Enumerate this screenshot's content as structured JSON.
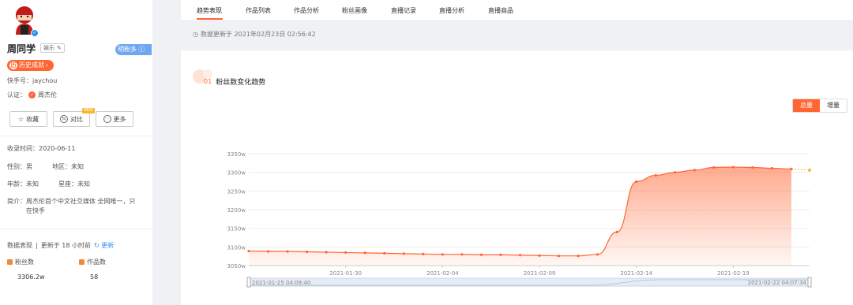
{
  "profile": {
    "name": "周同学",
    "category_tag": "娱乐",
    "fans_many_badge": "明粉多",
    "history_label": "历史成就",
    "kuaishou_id": "快手号：jaychou",
    "cert_label": "认证：",
    "cert_value": "周杰伦",
    "collect_button": "收藏",
    "compare_button": "对比",
    "compare_new": "NEW",
    "more_button": "更多",
    "collected_time": "收录时间：2020-06-11",
    "gender": "性别：男",
    "region": "地区：未知",
    "age": "年龄：未知",
    "zodiac": "星座：未知",
    "intro_label": "简介：",
    "intro_text": "周杰伦首个中文社交媒体 全网唯一，只在快手",
    "data_perf": "数据表现",
    "updated_ago": "更新于 18 小时前",
    "refresh": "更新",
    "fans_label": "粉丝数",
    "fans_value": "3306.2w",
    "works_label": "作品数",
    "works_value": "58"
  },
  "tabs": [
    "趋势表现",
    "作品列表",
    "作品分析",
    "粉丝画像",
    "直播记录",
    "直播分析",
    "直播商品"
  ],
  "update_info": "数据更新于 2021年02月23日 02:56:42",
  "section": {
    "num": "01",
    "title": "粉丝数变化趋势"
  },
  "toggle": {
    "total": "总量",
    "increment": "增量"
  },
  "chart_data": {
    "type": "area",
    "yunit": "w",
    "ylim": [
      3050,
      3350
    ],
    "yticks": [
      "3350w",
      "3300w",
      "3250w",
      "3200w",
      "3150w",
      "3100w",
      "3050w"
    ],
    "xticks": [
      "2021-01-30",
      "2021-02-04",
      "2021-02-09",
      "2021-02-14",
      "2021-02-19"
    ],
    "range_start": "2021-01-25 04:09:40",
    "range_end": "2021-02-22 04:07:34",
    "x": [
      "2021-01-25",
      "2021-01-26",
      "2021-01-27",
      "2021-01-28",
      "2021-01-29",
      "2021-01-30",
      "2021-01-31",
      "2021-02-01",
      "2021-02-02",
      "2021-02-03",
      "2021-02-04",
      "2021-02-05",
      "2021-02-06",
      "2021-02-07",
      "2021-02-08",
      "2021-02-09",
      "2021-02-10",
      "2021-02-11",
      "2021-02-12",
      "2021-02-13",
      "2021-02-14",
      "2021-02-15",
      "2021-02-16",
      "2021-02-17",
      "2021-02-18",
      "2021-02-19",
      "2021-02-20",
      "2021-02-21",
      "2021-02-22"
    ],
    "values": [
      3089,
      3088,
      3088,
      3087,
      3086,
      3085,
      3084,
      3083,
      3082,
      3081,
      3080,
      3080,
      3079,
      3079,
      3078,
      3077,
      3076,
      3076,
      3080,
      3140,
      3275,
      3292,
      3300,
      3306,
      3313,
      3314,
      3313,
      3311,
      3309
    ],
    "projected": 3306,
    "color": "#ff6633"
  }
}
